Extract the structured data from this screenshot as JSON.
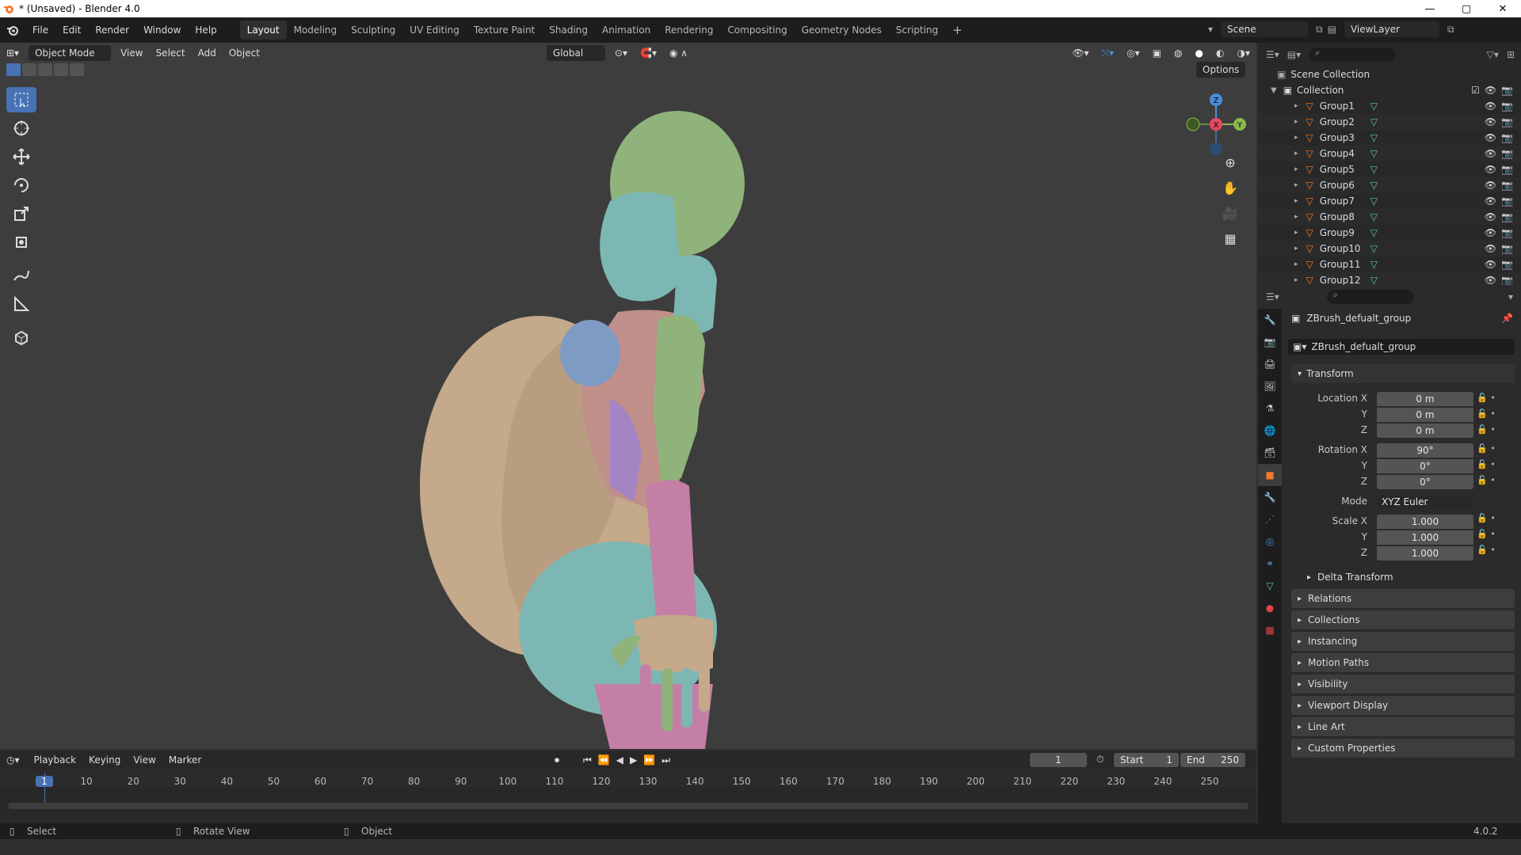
{
  "window": {
    "title": "* (Unsaved) - Blender 4.0",
    "minimize": "—",
    "maximize": "▢",
    "close": "✕"
  },
  "menu": [
    "File",
    "Edit",
    "Render",
    "Window",
    "Help"
  ],
  "workspaces": [
    "Layout",
    "Modeling",
    "Sculpting",
    "UV Editing",
    "Texture Paint",
    "Shading",
    "Animation",
    "Rendering",
    "Compositing",
    "Geometry Nodes",
    "Scripting"
  ],
  "workspace_add": "+",
  "scene": {
    "name": "Scene",
    "viewlayer": "ViewLayer"
  },
  "viewport_header": {
    "mode": "Object Mode",
    "menus": [
      "View",
      "Select",
      "Add",
      "Object"
    ],
    "transform_orientation": "Global",
    "options": "Options"
  },
  "gizmo": {
    "x": "X",
    "y": "Y",
    "z": "Z"
  },
  "outliner": {
    "root": "Scene Collection",
    "collection": "Collection",
    "items": [
      "Group1",
      "Group2",
      "Group3",
      "Group4",
      "Group5",
      "Group6",
      "Group7",
      "Group8",
      "Group9",
      "Group10",
      "Group11",
      "Group12"
    ]
  },
  "properties": {
    "object_name": "ZBrush_defualt_group",
    "data_name": "ZBrush_defualt_group",
    "transform_label": "Transform",
    "location_label": "Location X",
    "rotation_label": "Rotation X",
    "scale_label": "Scale X",
    "y_label": "Y",
    "z_label": "Z",
    "location": [
      "0 m",
      "0 m",
      "0 m"
    ],
    "rotation": [
      "90°",
      "0°",
      "0°"
    ],
    "mode_label": "Mode",
    "mode_value": "XYZ Euler",
    "scale": [
      "1.000",
      "1.000",
      "1.000"
    ],
    "delta_transform": "Delta Transform",
    "panels": [
      "Relations",
      "Collections",
      "Instancing",
      "Motion Paths",
      "Visibility",
      "Viewport Display",
      "Line Art",
      "Custom Properties"
    ]
  },
  "timeline": {
    "menus": [
      "Playback",
      "Keying",
      "View",
      "Marker"
    ],
    "current_frame": "1",
    "start_label": "Start",
    "start": "1",
    "end_label": "End",
    "end": "250",
    "ticks": [
      "1",
      "10",
      "20",
      "30",
      "40",
      "50",
      "60",
      "70",
      "80",
      "90",
      "100",
      "110",
      "120",
      "130",
      "140",
      "150",
      "160",
      "170",
      "180",
      "190",
      "200",
      "210",
      "220",
      "230",
      "240",
      "250"
    ]
  },
  "statusbar": {
    "select": "Select",
    "rotate": "Rotate View",
    "object": "Object",
    "version": "4.0.2"
  },
  "colors": {
    "accent": "#4772b3",
    "model_green": "#8fb37a",
    "model_teal": "#7db7b3",
    "model_pink": "#c47fa6",
    "model_tan": "#c4a98a",
    "model_blue": "#7e9bc4",
    "model_purple": "#a584c4"
  }
}
